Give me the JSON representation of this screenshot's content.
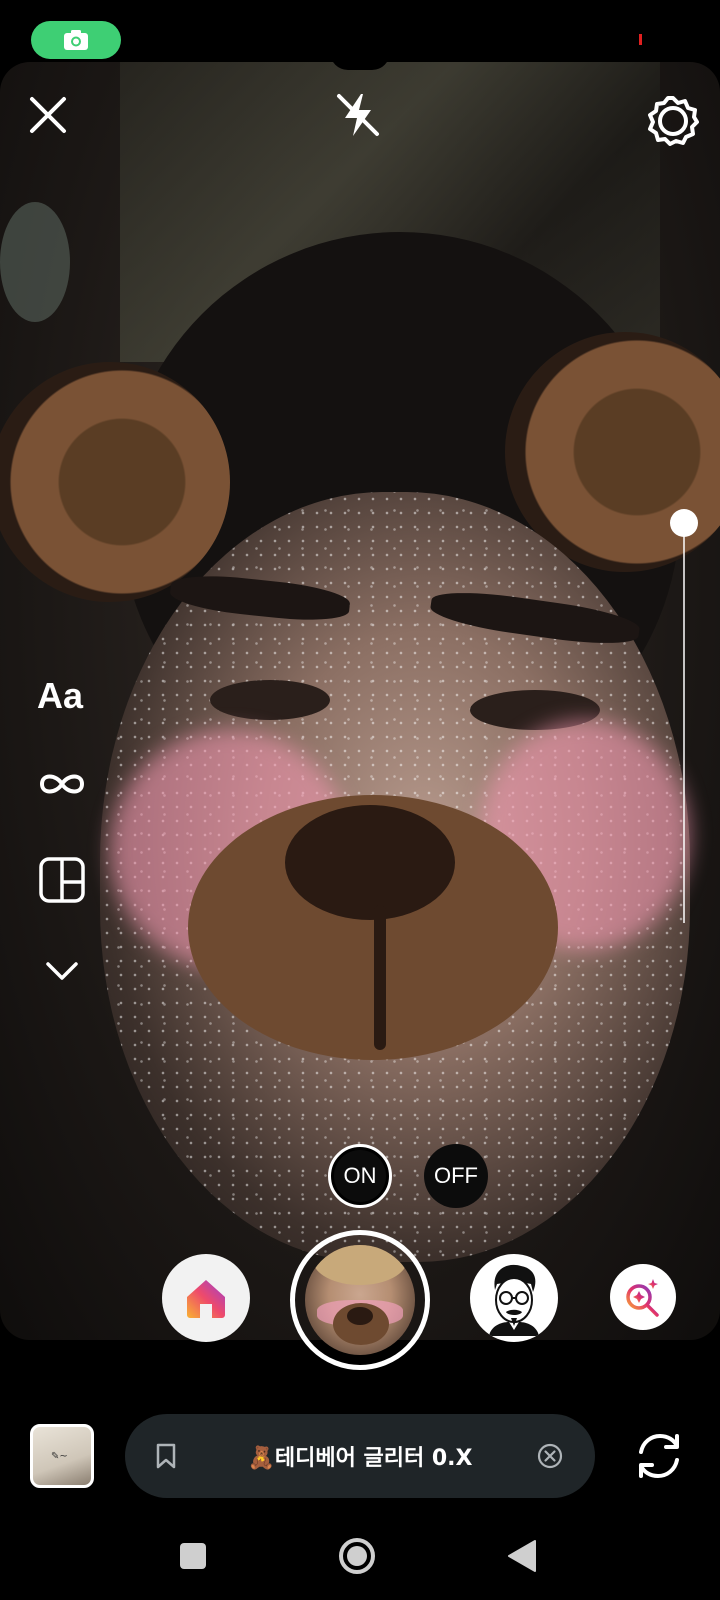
{
  "status_bar": {
    "camera_indicator_icon": "camera-icon",
    "recording_dot_color": "#e02020",
    "pill_color": "#3ecf74"
  },
  "top_controls": {
    "close_icon": "close-icon",
    "flash_icon": "flash-off-icon",
    "settings_icon": "settings-icon"
  },
  "left_toolbar": {
    "text_tool_label": "Aa",
    "boomerang_icon": "infinity-icon",
    "layout_icon": "layout-icon",
    "more_icon": "chevron-down-icon"
  },
  "zoom_slider": {
    "level": 1.0
  },
  "toggle": {
    "on_label": "ON",
    "off_label": "OFF",
    "selected": "on"
  },
  "effects_carousel": {
    "items": [
      {
        "name": "home-effect",
        "icon": "home-gradient-icon"
      },
      {
        "name": "teddy-bear-glitter",
        "icon": "selected-effect-preview",
        "selected": true
      },
      {
        "name": "man-glasses-effect",
        "icon": "man-with-glasses-icon"
      },
      {
        "name": "browse-effects",
        "icon": "search-sparkle-icon"
      }
    ]
  },
  "bottom_bar": {
    "gallery_icon": "gallery-thumbnail",
    "effect_name": "🧸테디베어 글리터 0.X",
    "bookmark_icon": "bookmark-icon",
    "clear_icon": "clear-circle-icon",
    "flip_icon": "flip-camera-icon"
  },
  "nav_bar": {
    "recents_icon": "recents-square-icon",
    "home_icon": "home-circle-icon",
    "back_icon": "back-triangle-icon"
  },
  "colors": {
    "pill_background": "#1f2528",
    "accent_pink": "#e1306c",
    "accent_orange": "#f7a23a"
  }
}
